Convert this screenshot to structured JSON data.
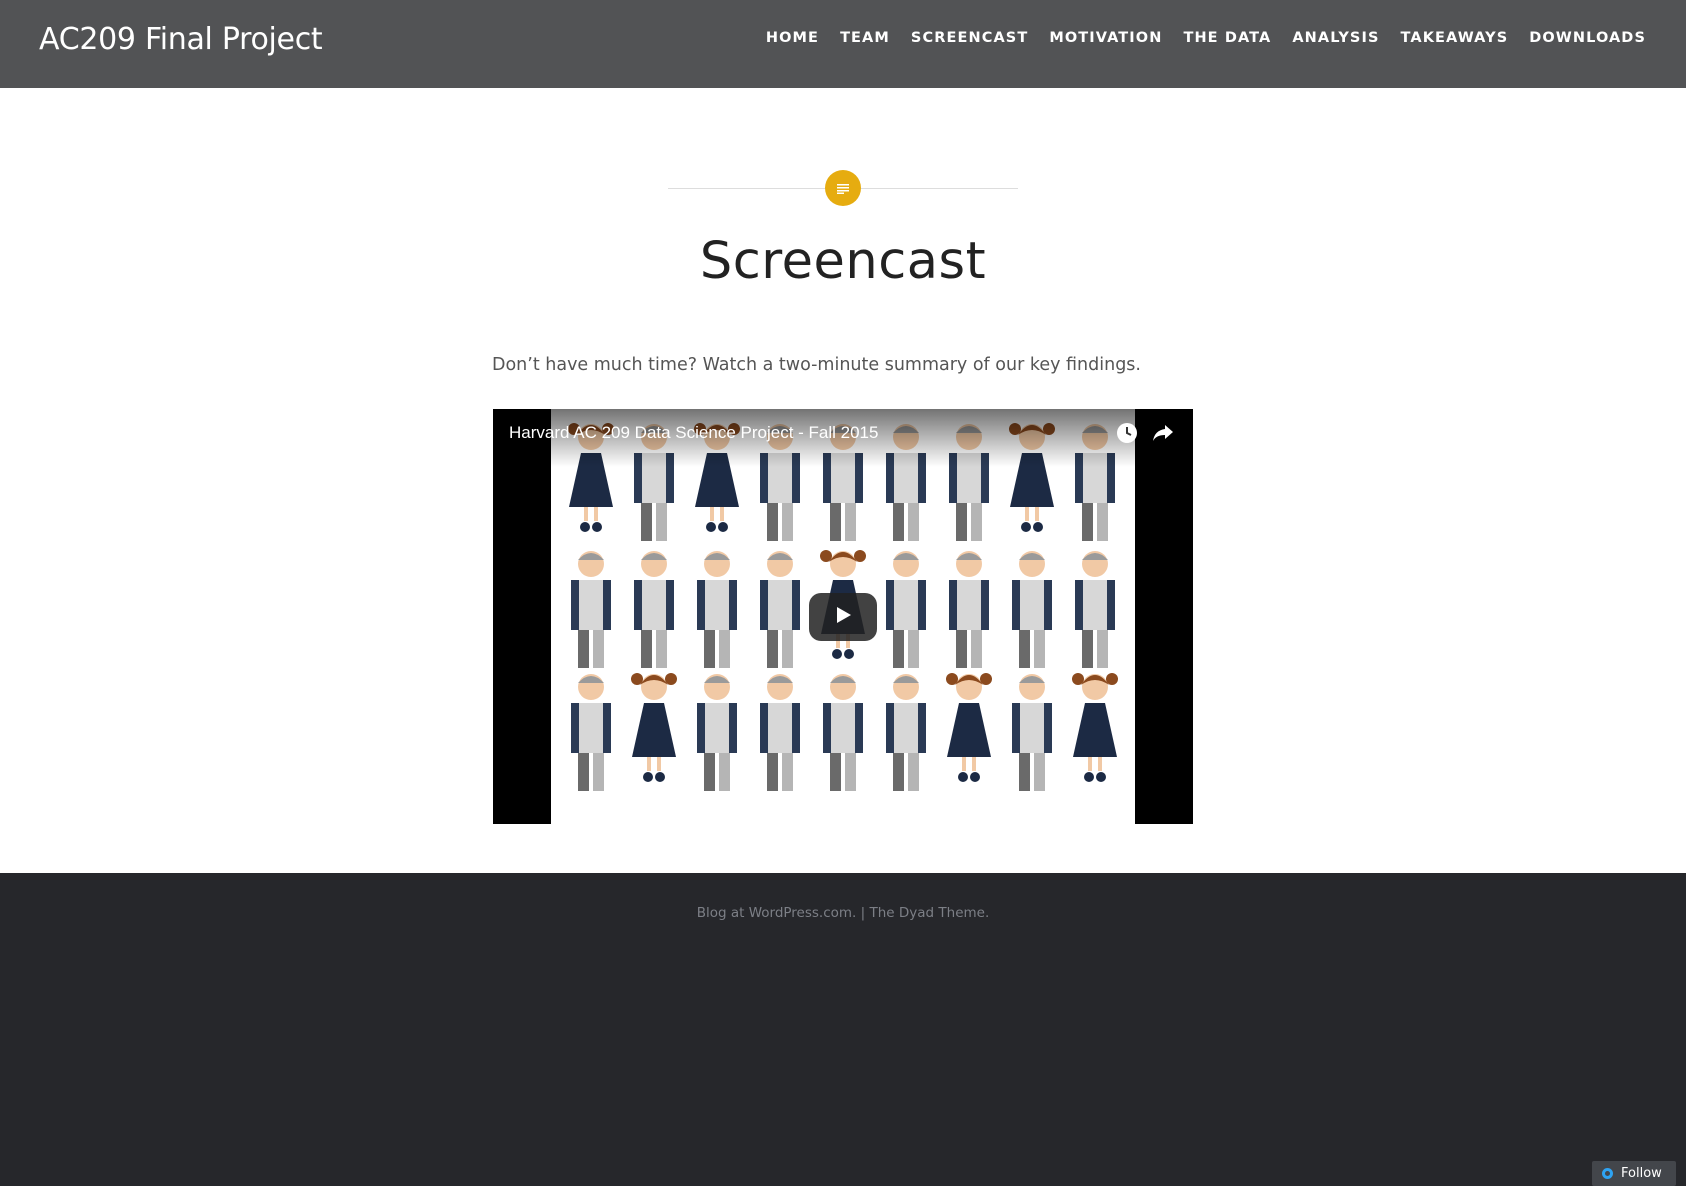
{
  "site": {
    "title": "AC209 Final Project"
  },
  "nav": {
    "items": [
      {
        "label": "HOME"
      },
      {
        "label": "TEAM"
      },
      {
        "label": "SCREENCAST"
      },
      {
        "label": "MOTIVATION"
      },
      {
        "label": "THE DATA"
      },
      {
        "label": "ANALYSIS"
      },
      {
        "label": "TAKEAWAYS"
      },
      {
        "label": "DOWNLOADS"
      }
    ]
  },
  "post": {
    "format_icon": "lines-icon",
    "title": "Screencast",
    "intro": "Don’t have much time? Watch a two-minute summary of our key findings."
  },
  "video": {
    "title": "Harvard AC 209 Data Science Project - Fall 2015",
    "controls": [
      "watch-later-icon",
      "share-icon",
      "play-icon"
    ]
  },
  "footer": {
    "credit_link": "Blog at WordPress.com.",
    "separator": "|",
    "theme_link": "The Dyad Theme."
  },
  "follow": {
    "label": "Follow"
  },
  "colors": {
    "header_bg": "#525355",
    "accent": "#e6ac10",
    "footer_bg": "#26272b"
  }
}
